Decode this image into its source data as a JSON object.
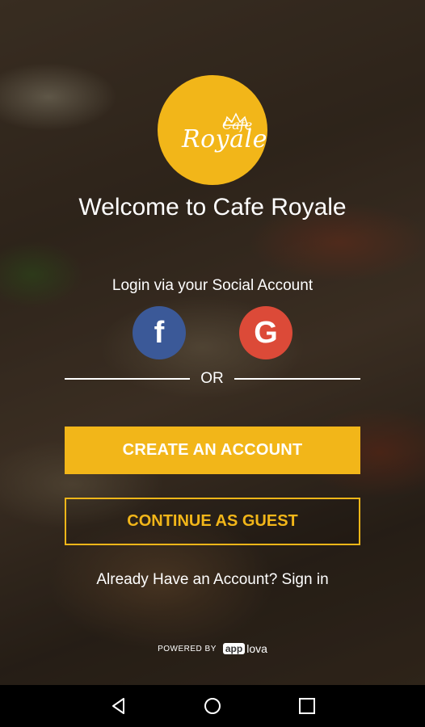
{
  "logo": {
    "brand_small": "Cafe",
    "brand_main": "Royale",
    "color": "#f2b619"
  },
  "welcome_title": "Welcome to Cafe Royale",
  "social": {
    "label": "Login via your Social Account",
    "facebook_glyph": "f",
    "google_glyph": "G",
    "facebook_icon": "facebook-icon",
    "google_icon": "google-icon",
    "facebook_color": "#3b5998",
    "google_color": "#dc4a38"
  },
  "divider_text": "OR",
  "buttons": {
    "create_account": "CREATE AN ACCOUNT",
    "continue_guest": "CONTINUE AS GUEST"
  },
  "signin_text": "Already Have an Account? Sign in",
  "footer": {
    "powered_by": "POWERED BY",
    "brand_badge": "app",
    "brand_rest": "lova"
  },
  "navbar": {
    "back_icon": "back-icon",
    "home_icon": "home-icon",
    "recent_icon": "recent-apps-icon"
  }
}
